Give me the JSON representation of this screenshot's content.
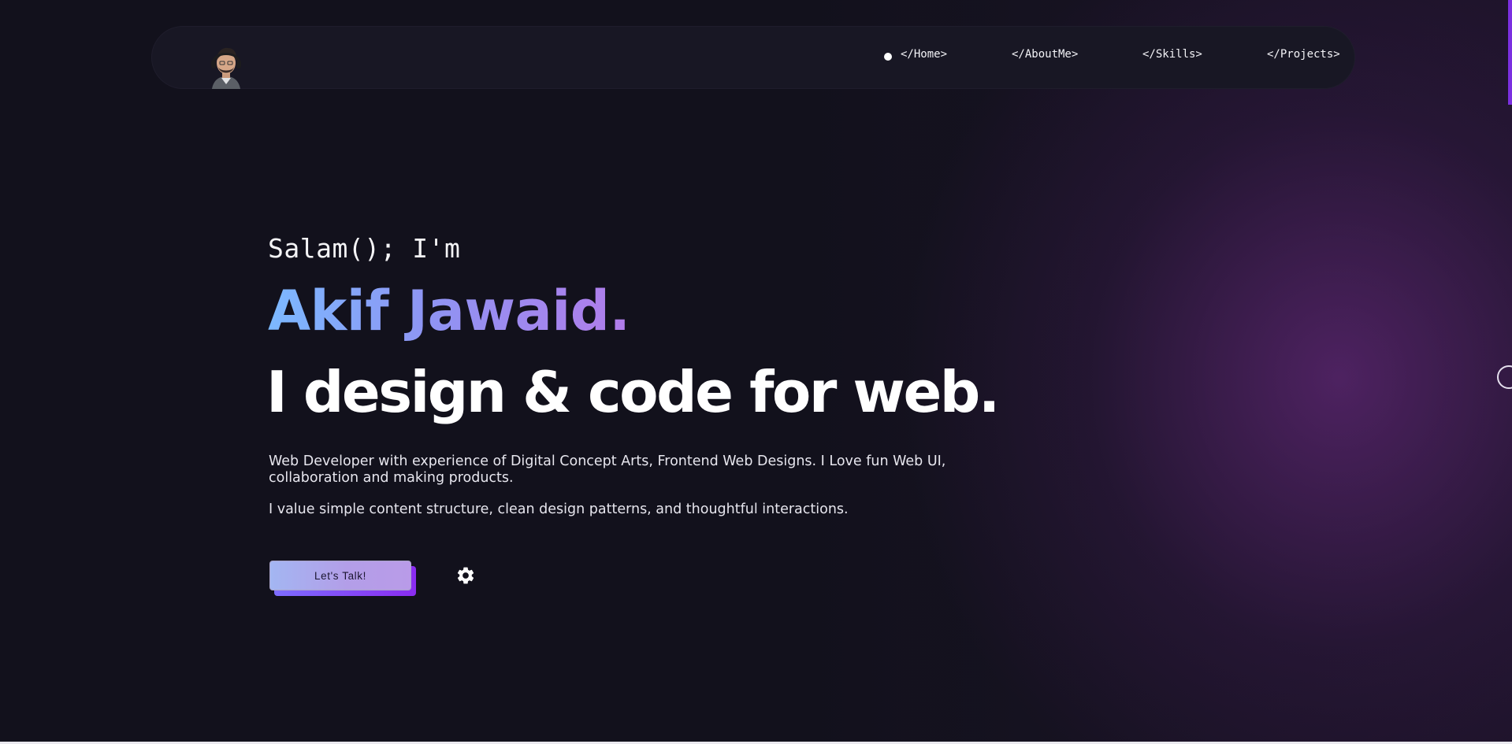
{
  "nav": {
    "avatar_icon": "avatar-icon",
    "links": [
      {
        "label": "</Home>",
        "active": true
      },
      {
        "label": "</AboutMe>",
        "active": false
      },
      {
        "label": "</Skills>",
        "active": false
      },
      {
        "label": "</Projects>",
        "active": false
      }
    ]
  },
  "hero": {
    "greeting": "Salam(); I'm",
    "name": "Akif Jawaid.",
    "tagline": "I design & code for web.",
    "bio": "Web Developer with experience of Digital Concept Arts, Frontend Web Designs. I Love fun Web UI, collaboration and making products.",
    "bio2": "I value simple content structure, clean design patterns, and thoughtful interactions.",
    "cta_label": "Let's Talk!",
    "settings_icon": "gear-icon"
  },
  "colors": {
    "background": "#12111c",
    "accent": "#7b2fe0",
    "gradient_start": "#7cb9ff",
    "gradient_end": "#b17cea"
  }
}
